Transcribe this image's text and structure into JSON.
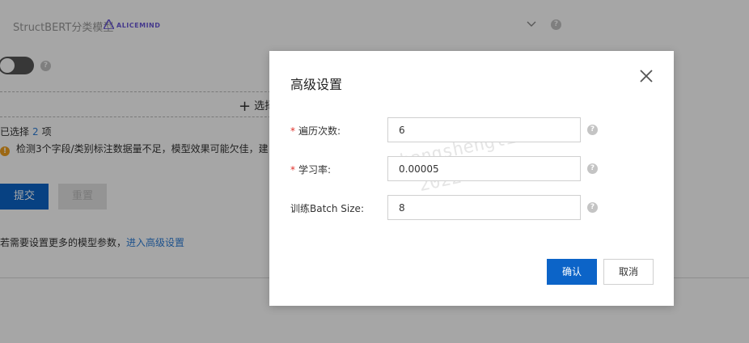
{
  "background": {
    "model_name": "StructBERT分类模型",
    "brand_text": "ALICEMIND",
    "add_label": "选择",
    "selected_prefix": "已选择",
    "selected_count": "2",
    "selected_suffix": "项",
    "warning_text": "检测3个字段/类别标注数据量不足，模型效果可能欠佳，建",
    "submit_label": "提交",
    "reset_label": "重置",
    "hint_text": "若需要设置更多的模型参数，",
    "hint_link": "进入高级设置"
  },
  "modal": {
    "title": "高级设置",
    "fields": [
      {
        "label": "遍历次数:",
        "required": "*",
        "value": "6"
      },
      {
        "label": "学习率:",
        "required": "*",
        "value": "0.00005"
      },
      {
        "label": "训练Batch Size:",
        "value": "8"
      }
    ],
    "watermark_line1": "zhangshenglin.dml",
    "watermark_line2": "2022-02-28",
    "ok_label": "确认",
    "cancel_label": "取消"
  },
  "colors": {
    "primary": "#0c64c8",
    "link": "#2f7fd8",
    "required": "#e0302a",
    "warning": "#f0a020"
  }
}
